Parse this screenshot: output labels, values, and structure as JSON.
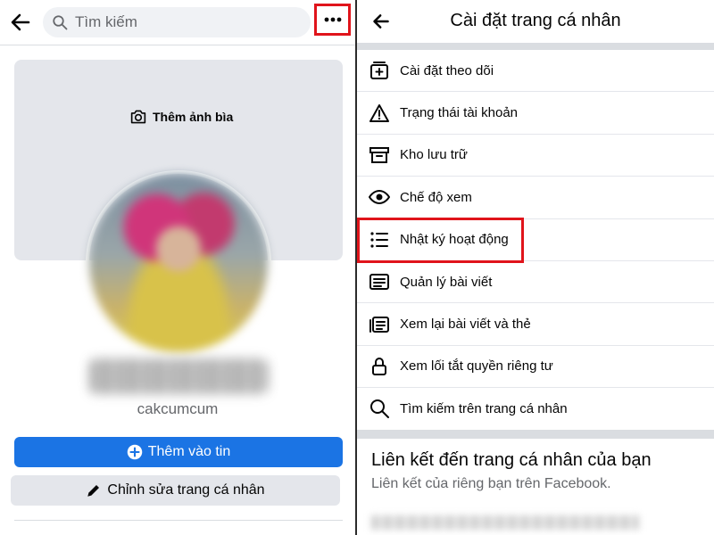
{
  "left": {
    "search": {
      "placeholder": "Tìm kiếm"
    },
    "cover": {
      "add_cover_label": "Thêm ảnh bìa"
    },
    "profile": {
      "username": "cakcumcum"
    },
    "buttons": {
      "add_to_story": "Thêm vào tin",
      "edit_profile": "Chỉnh sửa trang cá nhân"
    },
    "highlight_color": "#e0141b"
  },
  "right": {
    "title": "Cài đặt trang cá nhân",
    "menu": [
      {
        "label": "Cài đặt theo dõi",
        "icon": "follow-settings-icon"
      },
      {
        "label": "Trạng thái tài khoản",
        "icon": "warning-icon"
      },
      {
        "label": "Kho lưu trữ",
        "icon": "archive-icon"
      },
      {
        "label": "Chế độ xem",
        "icon": "eye-icon"
      },
      {
        "label": "Nhật ký hoạt động",
        "icon": "list-icon"
      },
      {
        "label": "Quản lý bài viết",
        "icon": "posts-icon"
      },
      {
        "label": "Xem lại bài viết và thẻ",
        "icon": "review-icon"
      },
      {
        "label": "Xem lối tắt quyền riêng tư",
        "icon": "lock-icon"
      },
      {
        "label": "Tìm kiếm trên trang cá nhân",
        "icon": "search-icon"
      }
    ],
    "link_section": {
      "title": "Liên kết đến trang cá nhân của bạn",
      "subtitle": "Liên kết của riêng bạn trên Facebook."
    }
  },
  "colors": {
    "primary": "#1b74e4",
    "highlight": "#e0141b",
    "secondary_bg": "#e4e6eb"
  }
}
